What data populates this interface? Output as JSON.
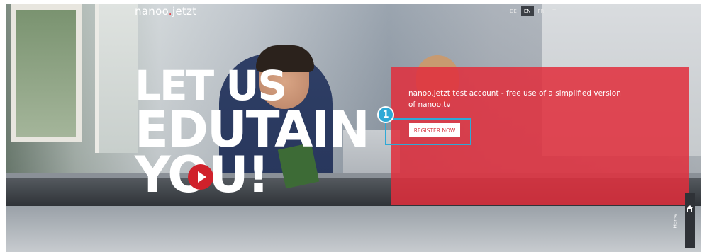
{
  "header": {
    "logo_main": "nanoo",
    "logo_dot": ".",
    "logo_suffix": "jetzt",
    "languages": [
      "DE",
      "EN",
      "FR",
      "IT"
    ],
    "active_language": "EN"
  },
  "hero": {
    "headline_line1": "LET US",
    "headline_line2": "EDUTAIN",
    "headline_line3": "YOU!"
  },
  "panel": {
    "text": "nanoo.jetzt test account - free use of a simplified version of nanoo.tv",
    "register_label": "REGISTER NOW",
    "accent_color": "#e12e3c"
  },
  "annotation": {
    "callout_number": "1",
    "highlight_color": "#2fa9d6"
  },
  "side_tab": {
    "label": "Home",
    "icon": "home-icon"
  },
  "media": {
    "play_icon": "play-icon"
  }
}
